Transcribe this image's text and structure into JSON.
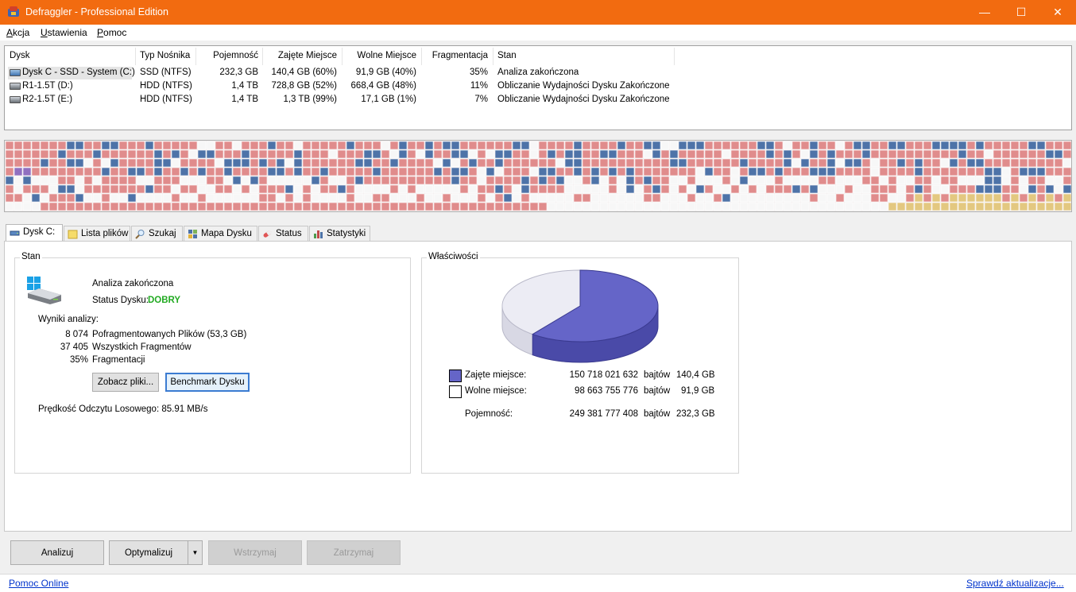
{
  "window": {
    "title": "Defraggler - Professional Edition",
    "minimize": "—",
    "maximize": "☐",
    "close": "✕"
  },
  "menu": [
    "Akcja",
    "Ustawienia",
    "Pomoc"
  ],
  "drive_list": {
    "headers": [
      "Dysk",
      "Typ Nośnika",
      "Pojemność",
      "Zajęte Miejsce",
      "Wolne Miejsce",
      "Fragmentacja",
      "Stan"
    ],
    "rows": [
      {
        "name": "Dysk C - SSD - System (C:)",
        "type": "SSD (NTFS)",
        "capacity": "232,3 GB",
        "used": "140,4 GB (60%)",
        "free": "91,9 GB (40%)",
        "frag": "35%",
        "status": "Analiza zakończona"
      },
      {
        "name": "R1-1.5T (D:)",
        "type": "HDD (NTFS)",
        "capacity": "1,4 TB",
        "used": "728,8 GB (52%)",
        "free": "668,4 GB (48%)",
        "frag": "11%",
        "status": "Obliczanie Wydajności Dysku Zakończone"
      },
      {
        "name": "R2-1.5T (E:)",
        "type": "HDD (NTFS)",
        "capacity": "1,4 TB",
        "used": "1,3 TB (99%)",
        "free": "17,1 GB (1%)",
        "frag": "7%",
        "status": "Obliczanie Wydajności Dysku Zakończone"
      }
    ]
  },
  "tabs": [
    {
      "label": "Dysk C:",
      "icon": "drive-icon"
    },
    {
      "label": "Lista plików",
      "icon": "folder-icon"
    },
    {
      "label": "Szukaj",
      "icon": "magnifier-icon"
    },
    {
      "label": "Mapa Dysku",
      "icon": "puzzle-icon"
    },
    {
      "label": "Status",
      "icon": "pill-icon"
    },
    {
      "label": "Statystyki",
      "icon": "bar-chart-icon"
    }
  ],
  "status_group": {
    "label": "Stan",
    "analysis_done": "Analiza zakończona",
    "disk_status_label": "Status Dysku:",
    "disk_status_value": "DOBRY",
    "disk_status_color": "#22aa22",
    "results_label": "Wyniki analizy:",
    "results": [
      {
        "value": "8 074",
        "label": "Pofragmentowanych Plików (53,3 GB)"
      },
      {
        "value": "37 405",
        "label": "Wszystkich Fragmentów"
      },
      {
        "value": "35%",
        "label": "Fragmentacji"
      }
    ],
    "view_files_button": "Zobacz pliki...",
    "benchmark_button": "Benchmark Dysku",
    "read_speed": "Prędkość Odczytu Losowego: 85.91 MB/s"
  },
  "properties_group": {
    "label": "Właściwości",
    "used_label": "Zajęte miejsce:",
    "used_bytes": "150 718 021 632",
    "used_unit": "bajtów",
    "used_size": "140,4 GB",
    "free_label": "Wolne miejsce:",
    "free_bytes": "98 663 755 776",
    "free_unit": "bajtów",
    "free_size": "91,9 GB",
    "capacity_label": "Pojemność:",
    "capacity_bytes": "249 381 777 408",
    "capacity_unit": "bajtów",
    "capacity_size": "232,3 GB",
    "used_color": "#6565c8",
    "free_color": "#ececf4",
    "used_fraction": 0.6044
  },
  "actions": {
    "analyze": "Analizuj",
    "optimize": "Optymalizuj",
    "pause": "Wstrzymaj",
    "stop": "Zatrzymaj"
  },
  "footer": {
    "help_link": "Pomoc Online",
    "update_link": "Sprawdź aktualizacje..."
  },
  "map_colors": {
    "empty": "#f7f7f7",
    "fragmented": "#e08c8c",
    "contiguous": "#4e73a8",
    "mft": "#9070c0",
    "reserved": "#e3c880"
  }
}
